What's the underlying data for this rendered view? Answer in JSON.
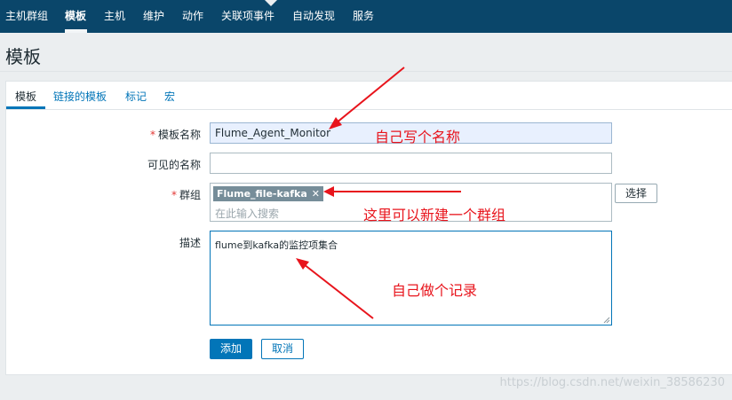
{
  "nav": {
    "items": [
      "主机群组",
      "模板",
      "主机",
      "维护",
      "动作",
      "关联项事件",
      "自动发现",
      "服务"
    ],
    "active_index": 1
  },
  "page": {
    "title": "模板"
  },
  "tabs": [
    "模板",
    "链接的模板",
    "标记",
    "宏"
  ],
  "form": {
    "template_name": {
      "label": "模板名称",
      "value": "Flume_Agent_Monitor",
      "required": true
    },
    "visible_name": {
      "label": "可见的名称",
      "value": ""
    },
    "groups": {
      "label": "群组",
      "required": true,
      "selected": [
        "Flume_file-kafka"
      ],
      "placeholder": "在此输入搜索",
      "select_button": "选择"
    },
    "description": {
      "label": "描述",
      "value": "flume到kafka的监控项集合"
    },
    "add_button": "添加",
    "cancel_button": "取消"
  },
  "annotations": [
    "自己写个名称",
    "这里可以新建一个群组",
    "自己做个记录"
  ],
  "watermark": "https://blog.csdn.net/weixin_38586230",
  "colors": {
    "nav_bg": "#0a466a",
    "accent": "#0275b8",
    "required": "#e33734",
    "annotation": "#e8141c",
    "tag_bg": "#768d99"
  },
  "icons": [
    "remove-tag-icon",
    "resize-handle-icon",
    "arrow-icon"
  ]
}
